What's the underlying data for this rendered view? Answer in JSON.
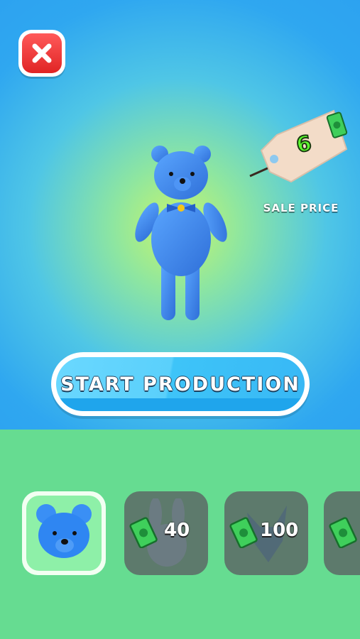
{
  "header": {
    "close_icon": "close-icon"
  },
  "product": {
    "sale_price": "6",
    "sale_price_label": "SALE PRICE",
    "currency_icon": "cash-icon",
    "colors": {
      "bear": "#3d8ef0",
      "bowtie": "#f5c518"
    }
  },
  "actions": {
    "start_label": "START PRODUCTION"
  },
  "shop": {
    "items": [
      {
        "name": "blue-bear",
        "price": "",
        "selected": true,
        "locked": false
      },
      {
        "name": "bunny",
        "price": "40",
        "selected": false,
        "locked": true
      },
      {
        "name": "cat",
        "price": "100",
        "selected": false,
        "locked": true
      },
      {
        "name": "unknown",
        "price": "",
        "selected": false,
        "locked": true
      }
    ]
  }
}
